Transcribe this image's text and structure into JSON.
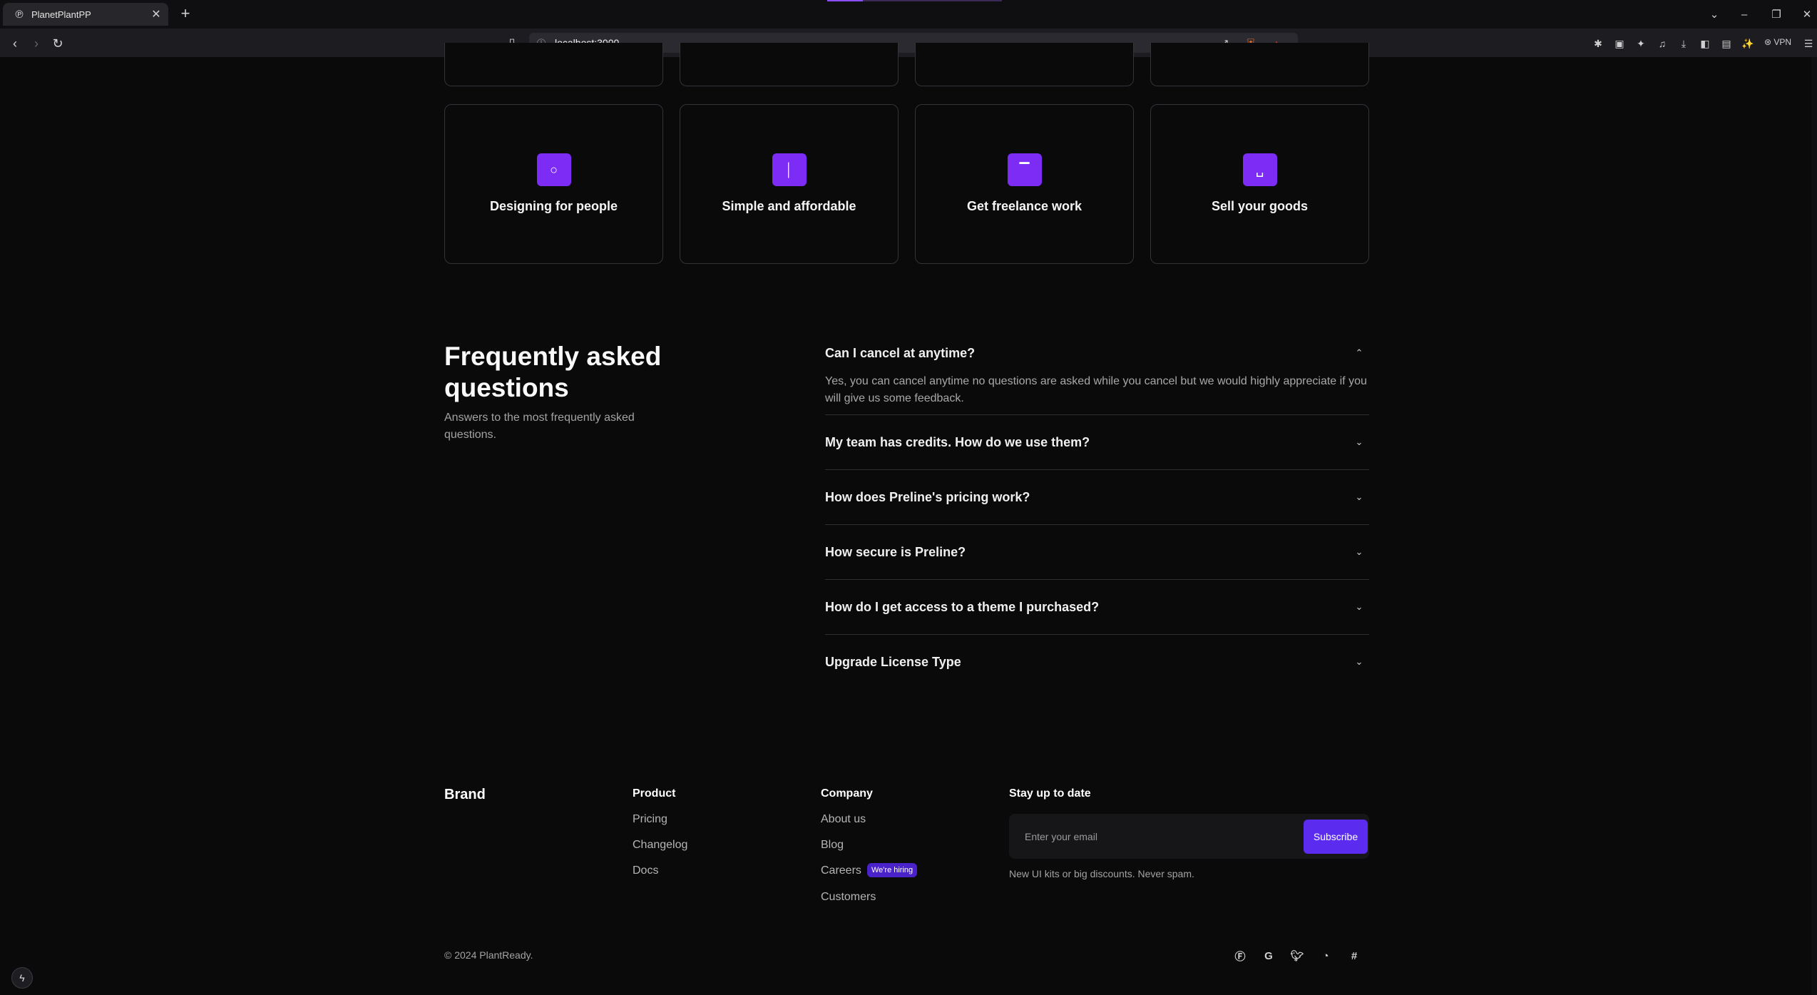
{
  "browser": {
    "tab_title": "PlanetPlantPP",
    "url": "localhost:3000",
    "vpn_label": "VPN"
  },
  "features": [
    {
      "label": "Designing for people",
      "icon": "circle-icon"
    },
    {
      "label": "Simple and affordable",
      "icon": "bar-icon"
    },
    {
      "label": "Get freelance work",
      "icon": "top-line-icon"
    },
    {
      "label": "Sell your goods",
      "icon": "tray-icon"
    }
  ],
  "faq": {
    "title": "Frequently asked questions",
    "subtitle": "Answers to the most frequently asked questions.",
    "items": [
      {
        "question": "Can I cancel at anytime?",
        "answer": "Yes, you can cancel anytime no questions are asked while you cancel but we would highly appreciate if you will give us some feedback.",
        "expanded": true
      },
      {
        "question": "My team has credits. How do we use them?",
        "expanded": false
      },
      {
        "question": "How does Preline's pricing work?",
        "expanded": false
      },
      {
        "question": "How secure is Preline?",
        "expanded": false
      },
      {
        "question": "How do I get access to a theme I purchased?",
        "expanded": false
      },
      {
        "question": "Upgrade License Type",
        "expanded": false
      }
    ]
  },
  "footer": {
    "brand": "Brand",
    "product": {
      "heading": "Product",
      "links": [
        "Pricing",
        "Changelog",
        "Docs"
      ]
    },
    "company": {
      "heading": "Company",
      "links": [
        "About us",
        "Blog",
        "Careers",
        "Customers"
      ],
      "hiring_badge": "We're hiring"
    },
    "newsletter": {
      "heading": "Stay up to date",
      "placeholder": "Enter your email",
      "button": "Subscribe",
      "note": "New UI kits or big discounts. Never spam."
    },
    "copyright": "© 2024 PlantReady.",
    "social": [
      "facebook-icon",
      "google-icon",
      "twitter-icon",
      "github-icon",
      "slack-icon"
    ]
  },
  "colors": {
    "accent": "#7c2cf5",
    "button": "#5b2cf0",
    "background": "#0a0a0b"
  }
}
